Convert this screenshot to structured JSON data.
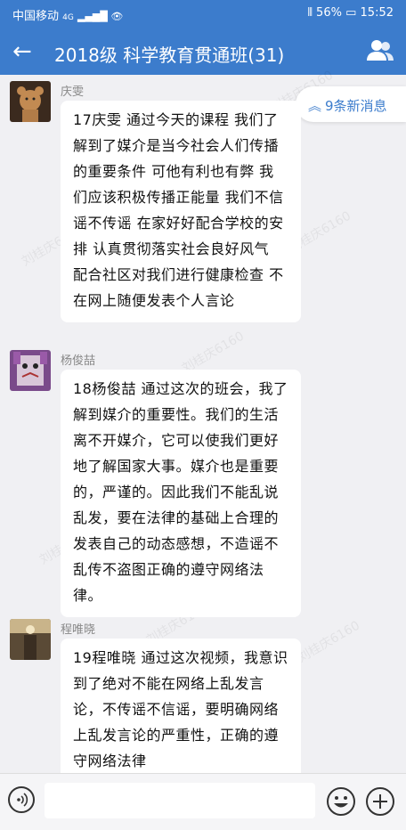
{
  "statusbar": {
    "carrier": "中国移动",
    "network": "4G",
    "battery": "56%",
    "time": "15:52"
  },
  "header": {
    "back_icon": "arrow-left-icon",
    "title": "2018级 科学教育贯通班(31)",
    "members_icon": "group-icon"
  },
  "new_messages": {
    "label": "9条新消息",
    "icon": "double-chevron-up-icon"
  },
  "watermark": "刘桂庆6160",
  "messages": [
    {
      "sender": "庆雯",
      "text": "17庆雯 通过今天的课程 我们了解到了媒介是当今社会人们传播的重要条件 可他有利也有弊 我们应该积极传播正能量 我们不信谣不传谣 在家好好配合学校的安排 认真贯彻落实社会良好风气  配合社区对我们进行健康检查 不在网上随便发表个人言论"
    },
    {
      "sender": "杨俊喆",
      "text": "18杨俊喆 通过这次的班会，我了解到媒介的重要性。我们的生活离不开媒介，它可以使我们更好地了解国家大事。媒介也是重要的，严谨的。因此我们不能乱说乱发，要在法律的基础上合理的发表自己的动态感想，不造谣不乱传不盗图正确的遵守网络法律。"
    },
    {
      "sender": "程唯晓",
      "text": "19程唯晓 通过这次视频，我意识到了绝对不能在网络上乱发言论，不传谣不信谣，要明确网络上乱发言论的严重性，正确的遵守网络法律"
    }
  ],
  "composer": {
    "voice_icon": "voice-icon",
    "emoji_icon": "smiley-icon",
    "plus_icon": "plus-icon"
  }
}
